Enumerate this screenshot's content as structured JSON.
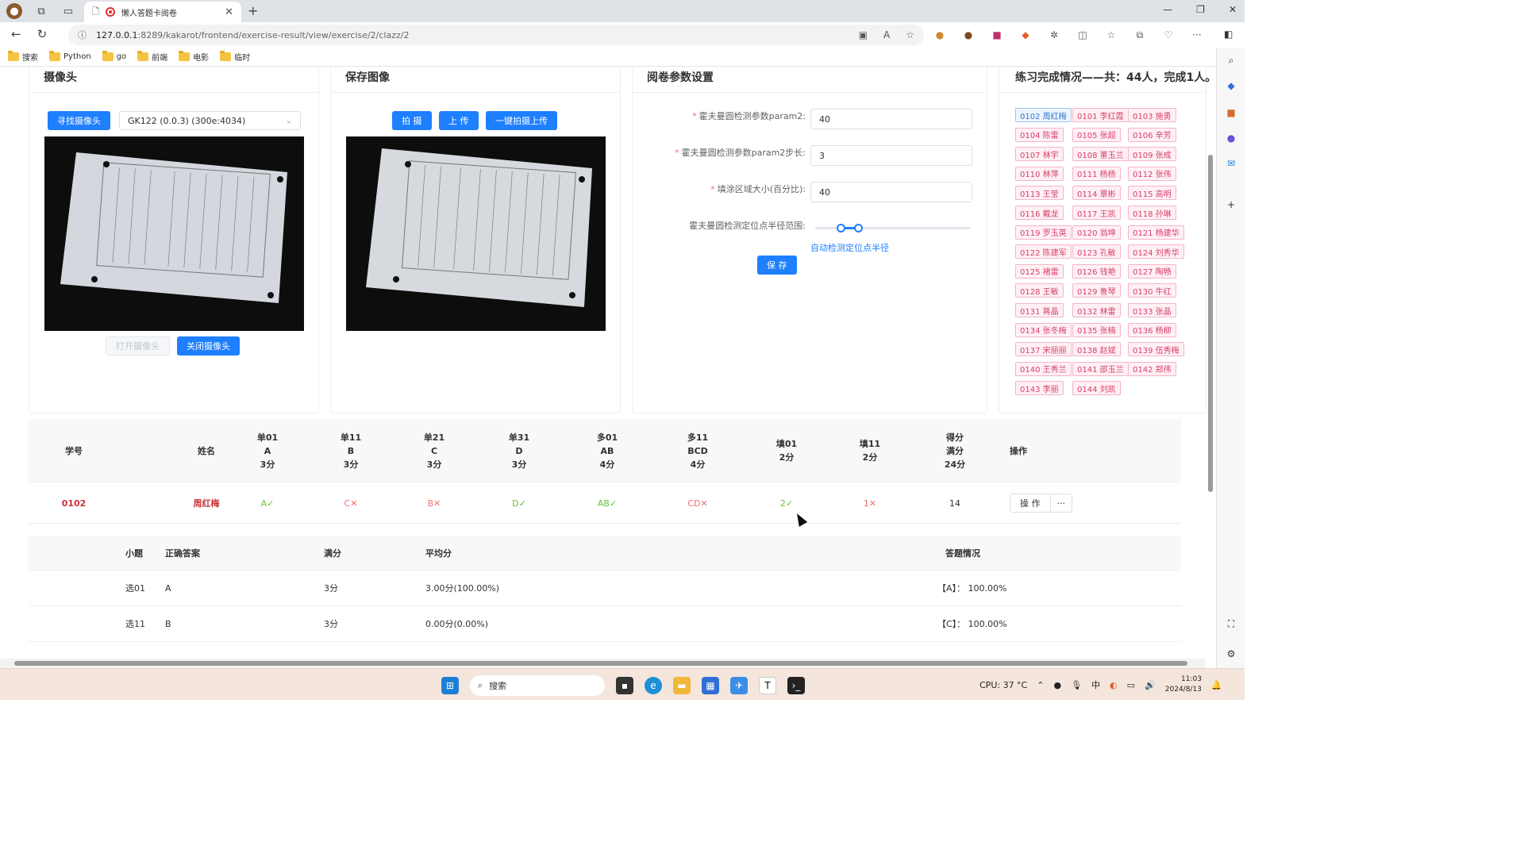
{
  "browser": {
    "tab_title": "懒人答题卡阅卷",
    "url_host": "127.0.0.1",
    "url_path": ":8289/kakarot/frontend/exercise-result/view/exercise/2/clazz/2",
    "bookmarks": [
      "搜索",
      "Python",
      "go",
      "前端",
      "电影",
      "临时"
    ]
  },
  "camera": {
    "title": "摄像头",
    "find_button": "寻找摄像头",
    "device": "GK122 (0.0.3)   (300e:4034)",
    "open_button": "打开摄像头",
    "close_button": "关闭摄像头"
  },
  "save_image": {
    "title": "保存图像",
    "shoot_button": "拍 摄",
    "upload_button": "上 传",
    "one_click_button": "一键拍摄上传"
  },
  "params": {
    "title": "阅卷参数设置",
    "param2_label": "霍夫曼圆检测参数param2:",
    "param2_value": "40",
    "param2_step_label": "霍夫曼圆检测参数param2步长:",
    "param2_step_value": "3",
    "fill_area_label": "填涂区域大小(百分比):",
    "fill_area_value": "40",
    "radius_label": "霍夫曼圆检测定位点半径范围:",
    "auto_detect_link": "自动检测定位点半径",
    "save_button": "保 存"
  },
  "completion": {
    "title": "练习完成情况——共：44人，完成1人。",
    "students": [
      "0102 周红梅",
      "0101 李红霞",
      "0103 施勇",
      "0104 陈雷",
      "0105 张超",
      "0106 辛芳",
      "0107 林宇",
      "0108 董玉兰",
      "0109 张成",
      "0110 林萍",
      "0111 杨杨",
      "0112 张伟",
      "0113 王莹",
      "0114 覃彬",
      "0115 高明",
      "0116 戴龙",
      "0117 王凯",
      "0118 孙琳",
      "0119 罗玉英",
      "0120 翁坤",
      "0121 杨建华",
      "0122 陈建军",
      "0123 孔敏",
      "0124 刘秀华",
      "0125 褚雷",
      "0126 钱艳",
      "0127 陶畅",
      "0128 王敏",
      "0129 鲁琴",
      "0130 牛红",
      "0131 蒋晶",
      "0132 林雷",
      "0133 张晶",
      "0134 张冬梅",
      "0135 张楠",
      "0136 杨柳",
      "0137 宋丽丽",
      "0138 赵斌",
      "0139 伍秀梅",
      "0140 王秀兰",
      "0141 邵玉兰",
      "0142 郑伟",
      "0143 李丽",
      "0144 刘凯"
    ]
  },
  "table": {
    "headers": [
      [
        "学号"
      ],
      [
        "姓名"
      ],
      [
        "单01",
        "A",
        "3分"
      ],
      [
        "单11",
        "B",
        "3分"
      ],
      [
        "单21",
        "C",
        "3分"
      ],
      [
        "单31",
        "D",
        "3分"
      ],
      [
        "多01",
        "AB",
        "4分"
      ],
      [
        "多11",
        "BCD",
        "4分"
      ],
      [
        "填01",
        "2分"
      ],
      [
        "填11",
        "2分"
      ],
      [
        "得分",
        "满分",
        "24分"
      ],
      [
        "操作"
      ]
    ],
    "row": {
      "id": "0102",
      "name": "周红梅",
      "answers": [
        {
          "text": "A✓",
          "ok": true
        },
        {
          "text": "C✕",
          "ok": false
        },
        {
          "text": "B✕",
          "ok": false
        },
        {
          "text": "D✓",
          "ok": true
        },
        {
          "text": "AB✓",
          "ok": true
        },
        {
          "text": "CD✕",
          "ok": false
        },
        {
          "text": "2✓",
          "ok": true
        },
        {
          "text": "1✕",
          "ok": false
        }
      ],
      "score": "14",
      "action_button": "操 作",
      "more_button": "···"
    }
  },
  "stats": {
    "headers": [
      "小题",
      "正确答案",
      "满分",
      "平均分",
      "答题情况"
    ],
    "rows": [
      [
        "选01",
        "A",
        "3分",
        "3.00分(100.00%)",
        "【A】： 100.00%"
      ],
      [
        "选11",
        "B",
        "3分",
        "0.00分(0.00%)",
        "【C】： 100.00%"
      ]
    ]
  },
  "taskbar": {
    "search": "搜索",
    "cpu": "CPU: 37 °C",
    "time": "11:03",
    "date": "2024/8/13"
  }
}
